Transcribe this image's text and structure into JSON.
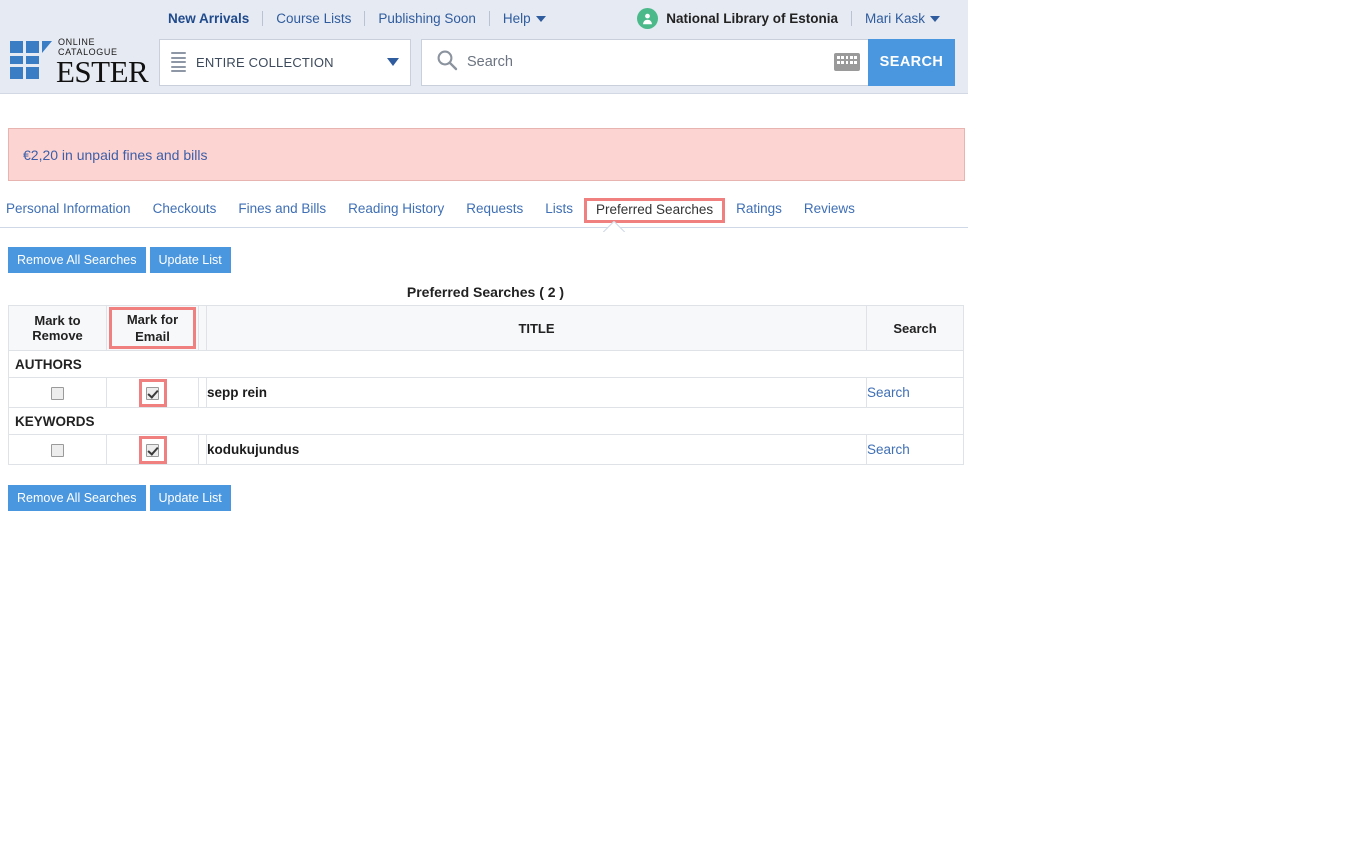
{
  "header": {
    "top_nav": [
      {
        "label": "New Arrivals",
        "active": true
      },
      {
        "label": "Course Lists",
        "active": false
      },
      {
        "label": "Publishing Soon",
        "active": false
      },
      {
        "label": "Help",
        "active": false,
        "has_caret": true
      }
    ],
    "institution": "National Library of Estonia",
    "account_name": "Mari Kask",
    "avatar_icon": "user-icon",
    "logo": {
      "sub": "ONLINE CATALOGUE",
      "main": "ESTER",
      "mark_color": "#3a7dc4"
    },
    "scope": {
      "selected": "ENTIRE COLLECTION",
      "menu_icon": "hamburger-icon",
      "caret_icon": "chevron-down-icon"
    },
    "search": {
      "placeholder": "Search",
      "value": "",
      "glass_icon": "search-icon",
      "keyboard_icon": "keyboard-icon",
      "button_label": "SEARCH",
      "button_color": "#4a97e0"
    }
  },
  "alert": {
    "text": "€2,20 in unpaid fines and bills",
    "bg_color": "#fcd5d2",
    "border_color": "#e8b4b0"
  },
  "tabs": [
    {
      "label": "Personal Information",
      "active": false
    },
    {
      "label": "Checkouts",
      "active": false
    },
    {
      "label": "Fines and Bills",
      "active": false
    },
    {
      "label": "Reading History",
      "active": false
    },
    {
      "label": "Requests",
      "active": false
    },
    {
      "label": "Lists",
      "active": false
    },
    {
      "label": "Preferred Searches",
      "active": true
    },
    {
      "label": "Ratings",
      "active": false
    },
    {
      "label": "Reviews",
      "active": false
    }
  ],
  "toolbar": {
    "remove_all_label": "Remove All Searches",
    "update_list_label": "Update List"
  },
  "list": {
    "title": "Preferred Searches ( 2 )",
    "count": 2,
    "columns": {
      "mark_remove": "Mark to\nRemove",
      "mark_remove_line1": "Mark to",
      "mark_remove_line2": "Remove",
      "mark_email_line1": "Mark for",
      "mark_email_line2": "Email",
      "title": "TITLE",
      "search": "Search"
    },
    "groups": [
      {
        "name": "AUTHORS",
        "rows": [
          {
            "title": "sepp rein",
            "mark_remove_checked": false,
            "mark_email_checked": true,
            "mark_email_highlighted": true,
            "search_label": "Search"
          }
        ]
      },
      {
        "name": "KEYWORDS",
        "rows": [
          {
            "title": "kodukujundus",
            "mark_remove_checked": false,
            "mark_email_checked": true,
            "mark_email_highlighted": true,
            "search_label": "Search"
          }
        ]
      }
    ]
  },
  "highlight_color": "#f08080"
}
